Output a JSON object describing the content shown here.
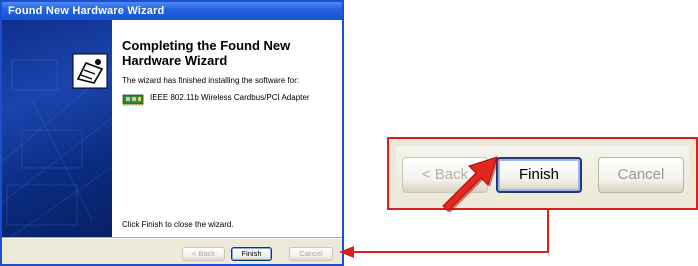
{
  "window": {
    "title": "Found New Hardware Wizard",
    "heading": "Completing the Found New Hardware Wizard",
    "description": "The wizard has finished installing the software for:",
    "device_name": "IEEE 802.11b Wireless Cardbus/PCI Adapter",
    "closing_text": "Click Finish to close the wizard."
  },
  "buttons": {
    "back": "< Back",
    "finish": "Finish",
    "cancel": "Cancel"
  },
  "zoom": {
    "back": "< Back",
    "finish": "Finish",
    "cancel": "Cancel"
  },
  "colors": {
    "title_bar": "#2160de",
    "banner": "#0e2f8e",
    "highlight": "#d8201c"
  },
  "icons": {
    "hardware": "hardware-wizard-icon",
    "device": "network-adapter-icon",
    "pointer": "red-arrow-icon"
  }
}
